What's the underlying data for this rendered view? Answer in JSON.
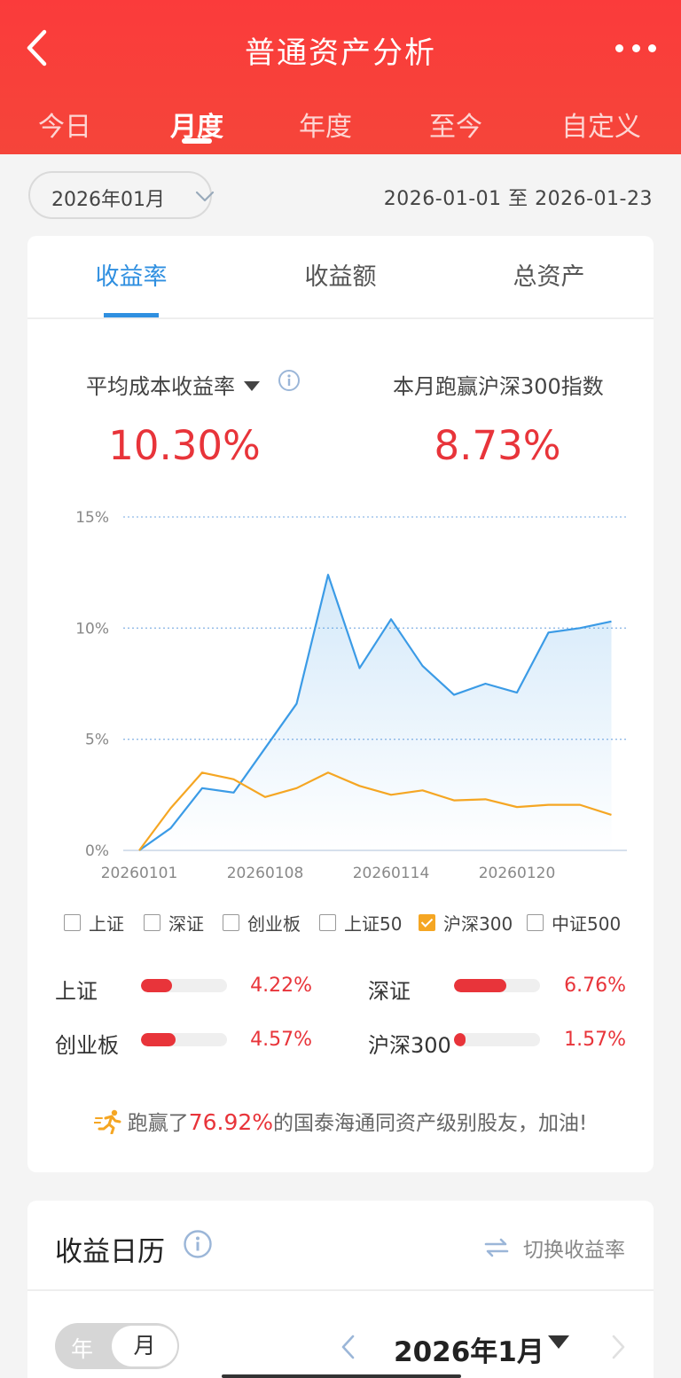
{
  "header": {
    "title": "普通资产分析",
    "back_icon": "chevron-left-icon",
    "more_icon": "more-dots-icon"
  },
  "period_tabs": [
    {
      "label": "今日",
      "active": false
    },
    {
      "label": "月度",
      "active": true
    },
    {
      "label": "年度",
      "active": false
    },
    {
      "label": "至今",
      "active": false
    },
    {
      "label": "自定义",
      "active": false
    }
  ],
  "date_selector": {
    "month": "2026年01月",
    "range": "2026-01-01 至 2026-01-23"
  },
  "content_tabs": [
    {
      "label": "收益率",
      "active": true
    },
    {
      "label": "收益额",
      "active": false
    },
    {
      "label": "总资产",
      "active": false
    }
  ],
  "metrics": {
    "left_label": "平均成本收益率",
    "left_value": "10.30%",
    "right_label": "本月跑赢沪深300指数",
    "right_value": "8.73%"
  },
  "chart_data": {
    "type": "line",
    "x": [
      "20260101",
      "20260102",
      "20260103",
      "20260104",
      "20260105",
      "20260106",
      "20260107",
      "20260108",
      "20260109",
      "20260110",
      "20260111",
      "20260112",
      "20260113",
      "20260114",
      "20260115",
      "20260116",
      "20260117",
      "20260118",
      "20260119",
      "20260120",
      "20260121",
      "20260122",
      "20260123"
    ],
    "series": [
      {
        "values": [
          0.0,
          1.0,
          2.8,
          2.6,
          4.6,
          6.6,
          12.4,
          8.2,
          10.4,
          8.3,
          7.0,
          7.5,
          7.1,
          9.8,
          10.0,
          10.3
        ],
        "x_index": [
          0,
          1,
          2,
          3,
          4,
          5,
          6,
          7,
          8,
          9,
          10,
          11,
          12,
          13,
          14,
          15
        ],
        "color": "#3b9be6"
      },
      {
        "values": [
          0.0,
          1.9,
          3.5,
          3.2,
          2.4,
          2.8,
          3.5,
          2.9,
          2.5,
          2.7,
          2.25,
          2.3,
          1.95,
          2.05,
          2.05,
          1.6
        ],
        "x_index": [
          0,
          1,
          2,
          3,
          4,
          5,
          6,
          7,
          8,
          9,
          10,
          11,
          12,
          13,
          14,
          15
        ],
        "color": "#f5a623"
      }
    ],
    "x_ticks": [
      "20260101",
      "20260108",
      "20260114",
      "20260120"
    ],
    "y_ticks": [
      "0%",
      "5%",
      "10%",
      "15%"
    ],
    "ylim": [
      0,
      15
    ],
    "grid": true
  },
  "legend": [
    {
      "label": "上证",
      "checked": false
    },
    {
      "label": "深证",
      "checked": false
    },
    {
      "label": "创业板",
      "checked": false
    },
    {
      "label": "上证50",
      "checked": false
    },
    {
      "label": "沪深300",
      "checked": true
    },
    {
      "label": "中证500",
      "checked": false
    }
  ],
  "benchmarks": [
    {
      "name": "上证",
      "value": "4.22%",
      "fill": 0.36
    },
    {
      "name": "深证",
      "value": "6.76%",
      "fill": 0.61
    },
    {
      "name": "创业板",
      "value": "4.57%",
      "fill": 0.4
    },
    {
      "name": "沪深300",
      "value": "1.57%",
      "fill": 0.13
    }
  ],
  "beat": {
    "prefix": "跑赢了",
    "percent": "76.92%",
    "suffix": "的国泰海通同资产级别股友，加油!"
  },
  "calendar": {
    "title": "收益日历",
    "switch_label": "切换收益率",
    "toggle_year": "年",
    "toggle_month": "月",
    "year_month": "2026年1月"
  },
  "colors": {
    "brand_red": "#f5453a",
    "accent_blue": "#2f8fe0",
    "value_red": "#e8343a",
    "index_orange": "#f5a623"
  }
}
